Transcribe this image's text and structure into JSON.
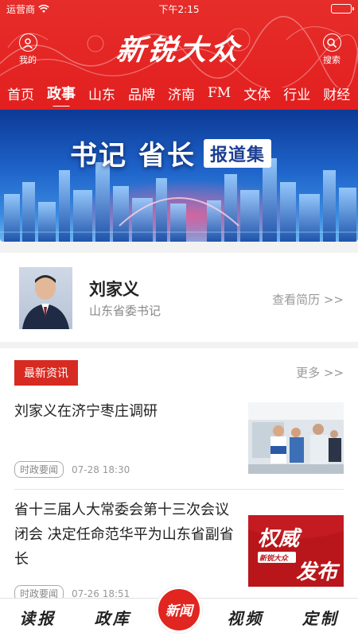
{
  "status_bar": {
    "carrier": "运营商",
    "time": "下午2:15"
  },
  "header": {
    "brand": "新锐大众",
    "left_button": {
      "label": "我的",
      "icon": "user-icon"
    },
    "right_button": {
      "label": "搜索",
      "icon": "search-icon"
    },
    "colors": {
      "primary": "#e21f1f"
    }
  },
  "channels": [
    "首页",
    "政事",
    "山东",
    "品牌",
    "济南",
    "FM",
    "文体",
    "行业",
    "财经"
  ],
  "active_channel": "政事",
  "banner": {
    "title_part1": "书记",
    "title_part2": "省长",
    "tag": "报道集"
  },
  "profile": {
    "name": "刘家义",
    "role": "山东省委书记",
    "more_label": "查看简历 >>"
  },
  "news": {
    "section_label": "最新资讯",
    "more_label": "更多 >>",
    "articles": [
      {
        "title": "刘家义在济宁枣庄调研",
        "badge": "时政要闻",
        "date": "07-28  18:30"
      },
      {
        "title": "省十三届人大常委会第十三次会议闭会 决定任命范华平为山东省副省长",
        "badge": "时政要闻",
        "date": "07-26  18:51",
        "thumb_text_top": "权威",
        "thumb_text_brand": "新锐大众",
        "thumb_text_bottom": "发布"
      }
    ]
  },
  "tabbar": {
    "tabs": [
      "读报",
      "政库",
      "新闻",
      "视频",
      "定制"
    ]
  }
}
